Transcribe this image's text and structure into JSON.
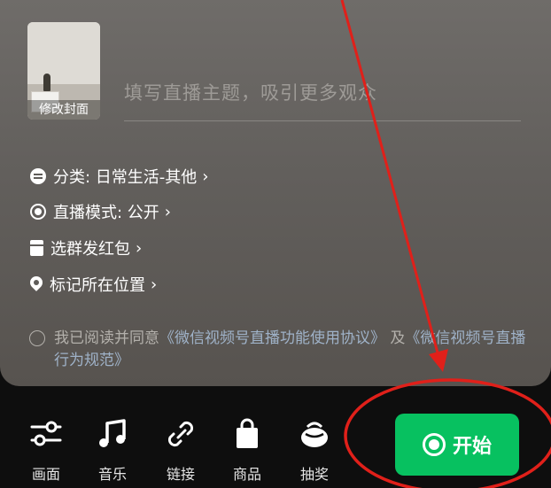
{
  "cover": {
    "caption": "修改封面"
  },
  "title": {
    "placeholder": "填写直播主题，吸引更多观众"
  },
  "settings": {
    "category": "分类: 日常生活-其他",
    "mode": "直播模式: 公开",
    "red_packet": "选群发红包",
    "location": "标记所在位置"
  },
  "agreement": {
    "prefix": "我已阅读并同意",
    "link1": "《微信视频号直播功能使用协议》",
    "and": "及",
    "link2": "《微信视频号直播行为规范》"
  },
  "toolbar": {
    "items": [
      {
        "label": "画面",
        "icon": "sliders-icon"
      },
      {
        "label": "音乐",
        "icon": "music-icon"
      },
      {
        "label": "链接",
        "icon": "link-icon"
      },
      {
        "label": "商品",
        "icon": "shopping-bag-icon"
      },
      {
        "label": "抽奖",
        "icon": "lottery-icon"
      }
    ],
    "start_label": "开始"
  },
  "colors": {
    "accent": "#07c160",
    "annotation": "#e0201a"
  },
  "chevron": "›"
}
